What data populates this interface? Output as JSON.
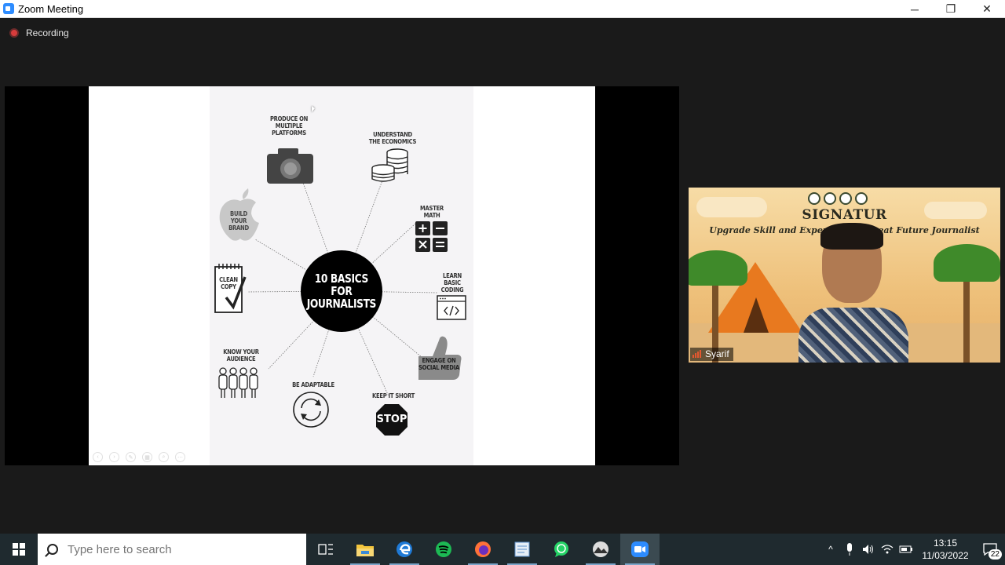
{
  "window": {
    "title": "Zoom Meeting",
    "minimize_label": "─",
    "restore_label": "❐",
    "close_label": "✕"
  },
  "meeting": {
    "recording_label": "Recording"
  },
  "slide": {
    "center_title": "10 BASICS\nFOR\nJOURNALISTS",
    "items": [
      {
        "label": "PRODUCE ON\nMULTIPLE\nPLATFORMS",
        "icon": "camera-icon"
      },
      {
        "label": "UNDERSTAND\nTHE ECONOMICS",
        "icon": "coins-icon"
      },
      {
        "label": "MASTER\nMATH",
        "icon": "calculator-icon"
      },
      {
        "label": "LEARN\nBASIC\nCODING",
        "icon": "code-window-icon"
      },
      {
        "label": "ENGAGE ON\nSOCIAL MEDIA",
        "icon": "thumbs-up-icon"
      },
      {
        "label": "KEEP IT SHORT",
        "icon": "stop-sign-icon"
      },
      {
        "label": "BE ADAPTABLE",
        "icon": "cycle-arrows-icon"
      },
      {
        "label": "KNOW YOUR\nAUDIENCE",
        "icon": "people-icon"
      },
      {
        "label": "CLEAN\nCOPY",
        "icon": "notepad-check-icon"
      },
      {
        "label": "BUILD\nYOUR\nBRAND",
        "icon": "apple-icon"
      }
    ],
    "stop_text": "STOP"
  },
  "video": {
    "participant_name": "Syarif",
    "banner_title": "SIGNATUR",
    "banner_subtitle": "Upgrade Skill and Experie          Great Future Journalist"
  },
  "taskbar": {
    "search_placeholder": "Type here to search",
    "apps": [
      "task-view-icon",
      "file-explorer-icon",
      "edge-icon",
      "spotify-icon",
      "firefox-icon",
      "document-app-icon",
      "whatsapp-icon",
      "mountain-app-icon",
      "zoom-icon"
    ],
    "time": "13:15",
    "date": "11/03/2022",
    "notification_count": "22"
  },
  "colors": {
    "zoom_blue": "#2d8cff",
    "recording_red": "#d73c3c",
    "taskbar_bg": "#1f2a2f",
    "meeting_bg": "#1a1a1a"
  }
}
